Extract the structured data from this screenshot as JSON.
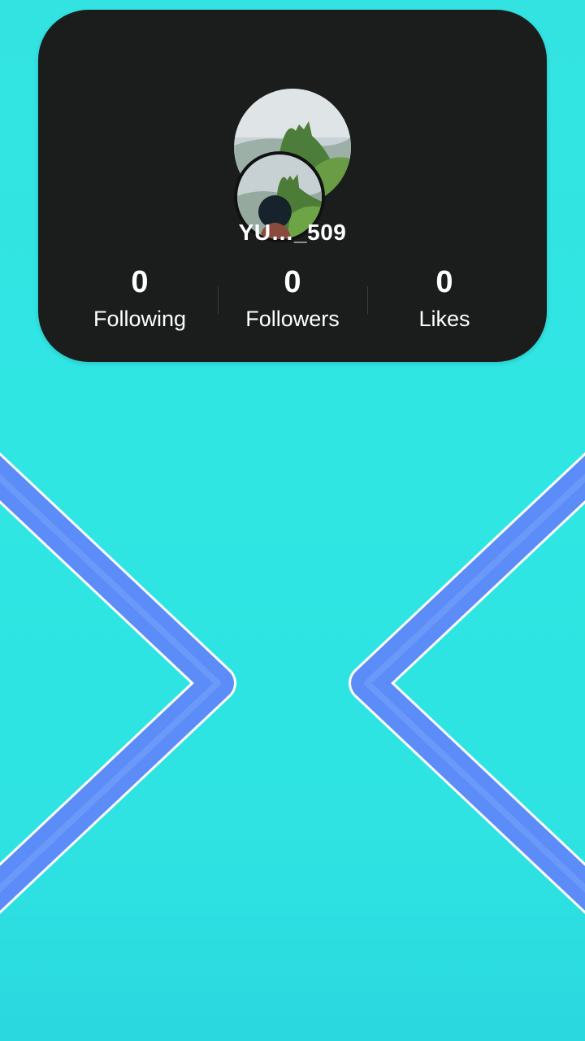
{
  "profile": {
    "username": "YU…_509",
    "stats": [
      {
        "value": "0",
        "label": "Following"
      },
      {
        "value": "0",
        "label": "Followers"
      },
      {
        "value": "0",
        "label": "Likes"
      }
    ]
  },
  "nav": {
    "left_icon": "chevron-left-icon",
    "right_icon": "chevron-right-icon"
  },
  "colors": {
    "background": "#2fe6e3",
    "card": "#1b1c1c",
    "chevron": "#5b8cf7",
    "chevron_outline": "#ffffff"
  }
}
